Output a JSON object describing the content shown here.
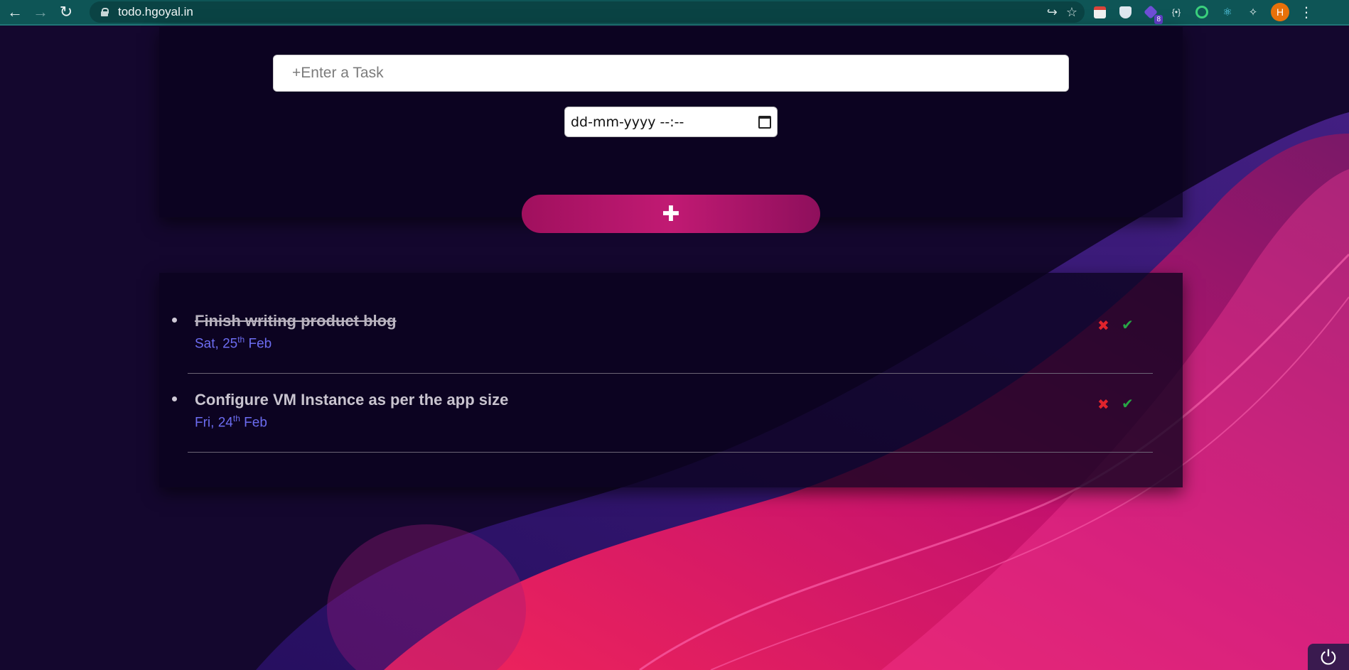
{
  "browser": {
    "url": "todo.hgoyal.in",
    "icons": [
      "back-icon",
      "forward-icon",
      "reload-icon",
      "lock-icon",
      "share-icon",
      "star-icon"
    ],
    "extensions": [
      "calendar-ext-icon",
      "shield-ext-icon",
      "puzzle-ext-icon",
      "braces-ext-icon",
      "target-ext-icon",
      "react-ext-icon",
      "extensions-icon"
    ],
    "extension_badge": "8",
    "avatar_initial": "H",
    "menu": "⋮"
  },
  "form": {
    "task_placeholder": "+Enter a Task",
    "date_placeholder": "dd-mm-yyyy --:--",
    "add_label": "✚"
  },
  "tasks": [
    {
      "title": "Finish writing product blog",
      "done": true,
      "date_day": "Sat, 25",
      "date_sup": "th",
      "date_month": " Feb"
    },
    {
      "title": "Configure VM Instance as per the app size",
      "done": false,
      "date_day": "Fri, 24",
      "date_sup": "th",
      "date_month": " Feb"
    }
  ],
  "actions": {
    "delete": "✖",
    "complete": "✔"
  },
  "colors": {
    "chrome": "#0e5556",
    "accent": "#c11a73",
    "date": "#6c6cf0",
    "delete": "#e0242c",
    "complete": "#27a545"
  },
  "power_icon": "⏻"
}
